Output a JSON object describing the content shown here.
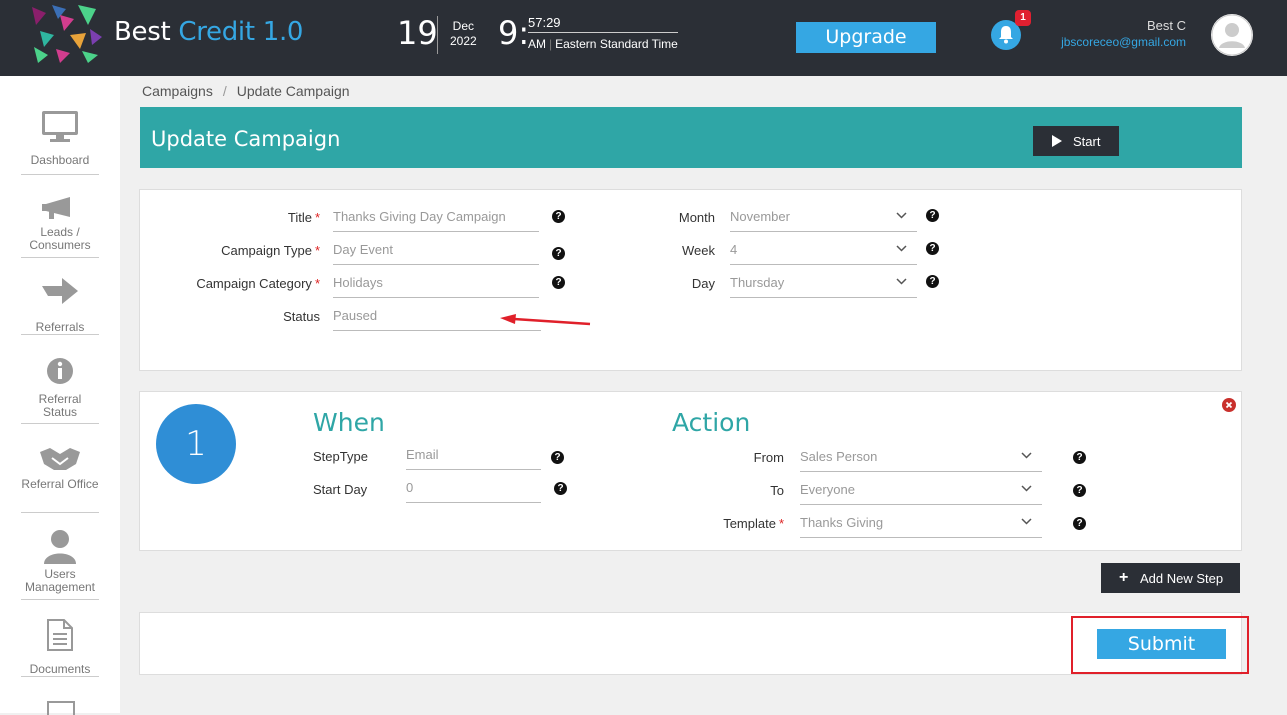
{
  "header": {
    "brand_main": "Best",
    "brand_accent": "Credit 1.0",
    "date_day": "19",
    "date_month": "Dec",
    "date_year": "2022",
    "time_hour": "9:",
    "time_minsec": "57:29",
    "time_ampm": "AM",
    "timezone": "Eastern Standard Time",
    "upgrade_label": "Upgrade",
    "notification_count": "1",
    "user_name": "Best C",
    "user_email": "jbscoreceo@gmail.com"
  },
  "sidebar": {
    "items": [
      {
        "label": "Dashboard",
        "icon": "monitor-icon"
      },
      {
        "label": "Leads / Consumers",
        "icon": "megaphone-icon"
      },
      {
        "label": "Referrals",
        "icon": "arrow-right-icon"
      },
      {
        "label": "Referral Status",
        "icon": "info-icon"
      },
      {
        "label": "Referral Office",
        "icon": "handshake-icon"
      },
      {
        "label": "Users Management",
        "icon": "user-icon"
      },
      {
        "label": "Documents",
        "icon": "document-icon"
      }
    ]
  },
  "breadcrumb": {
    "root": "Campaigns",
    "separator": "/",
    "current": "Update Campaign"
  },
  "page": {
    "title": "Update Campaign",
    "start_label": "Start"
  },
  "campaign": {
    "title_label": "Title",
    "title_value": "Thanks Giving Day Campaign",
    "type_label": "Campaign Type",
    "type_value": "Day Event",
    "category_label": "Campaign Category",
    "category_value": "Holidays",
    "status_label": "Status",
    "status_value": "Paused",
    "month_label": "Month",
    "month_value": "November",
    "week_label": "Week",
    "week_value": "4",
    "day_label": "Day",
    "day_value": "Thursday",
    "required_mark": "*",
    "help_mark": "?"
  },
  "step": {
    "number": "1",
    "when_title": "When",
    "action_title": "Action",
    "steptype_label": "StepType",
    "steptype_value": "Email",
    "startday_label": "Start Day",
    "startday_value": "0",
    "from_label": "From",
    "from_value": "Sales Person",
    "to_label": "To",
    "to_value": "Everyone",
    "template_label": "Template",
    "template_value": "Thanks Giving"
  },
  "actions": {
    "add_step_label": "Add New Step",
    "submit_label": "Submit"
  },
  "colors": {
    "topbar": "#2b2f36",
    "accent": "#35a7e3",
    "teal": "#2fa6a6",
    "annotation": "#e0202a"
  }
}
